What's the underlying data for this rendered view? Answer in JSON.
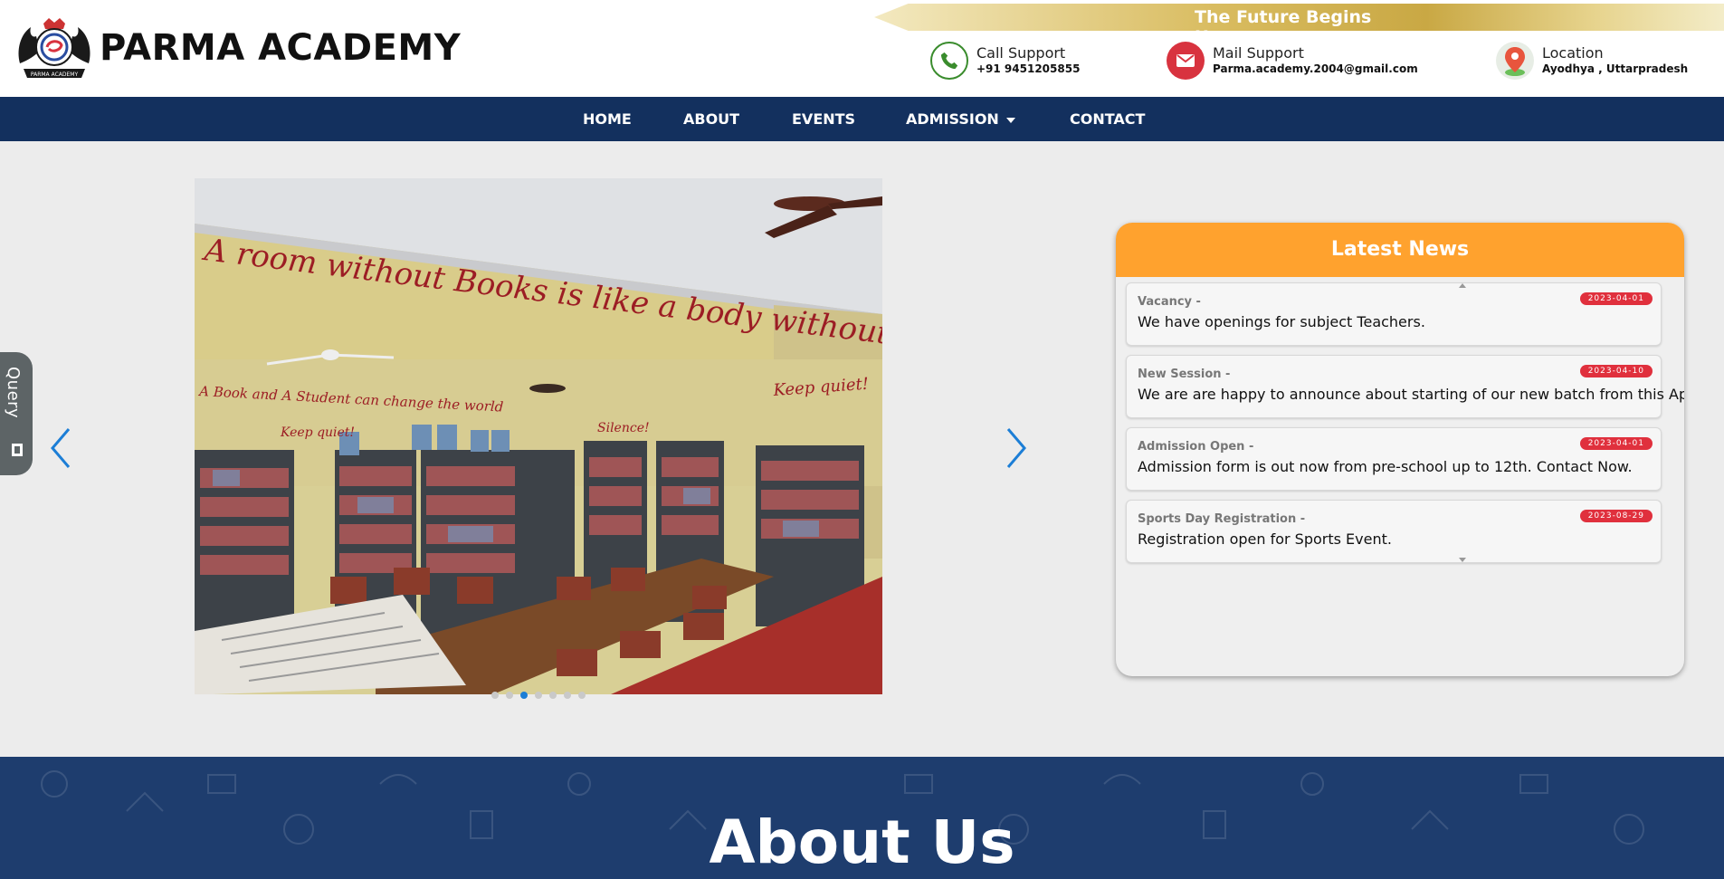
{
  "header": {
    "brand": "PARMA ACADEMY",
    "tagline": "The Future Begins Here",
    "contacts": [
      {
        "label": "Call Support",
        "value": "+91 9451205855",
        "icon": "phone-icon",
        "color": "#3a8c2d"
      },
      {
        "label": "Mail Support",
        "value": "Parma.academy.2004@gmail.com",
        "icon": "mail-icon",
        "color": "#d8333f"
      },
      {
        "label": "Location",
        "value": "Ayodhya , Uttarpradesh",
        "icon": "location-pin-icon",
        "color": "#e8553d"
      }
    ]
  },
  "nav": {
    "items": [
      "HOME",
      "ABOUT",
      "EVENTS",
      "ADMISSION",
      "CONTACT"
    ],
    "color": "#13305e"
  },
  "slider": {
    "active_index": 2,
    "count": 7,
    "wall_text": "A room without Books is like a body without a soul.",
    "left_text": "A Book and A Student can change the world",
    "keep_quiet": "Keep quiet!",
    "silence": "Silence!",
    "accent": "#1c7ed6"
  },
  "query_tab": {
    "label": "Query"
  },
  "news": {
    "heading": "Latest News",
    "header_color": "#ffa22e",
    "items": [
      {
        "title": "Vacancy -",
        "text": "We have openings for subject Teachers.",
        "date": "2023-04-01"
      },
      {
        "title": "New Session -",
        "text": "We are are happy to announce about starting of our new batch from this April.",
        "date": "2023-04-10"
      },
      {
        "title": "Admission Open -",
        "text": "Admission form is out now from pre-school up to 12th. Contact Now.",
        "date": "2023-04-01"
      },
      {
        "title": "Sports Day Registration -",
        "text": "Registration open for Sports Event.",
        "date": "2023-08-29"
      }
    ]
  },
  "about": {
    "title": "About Us",
    "color": "#1e3d6e"
  }
}
